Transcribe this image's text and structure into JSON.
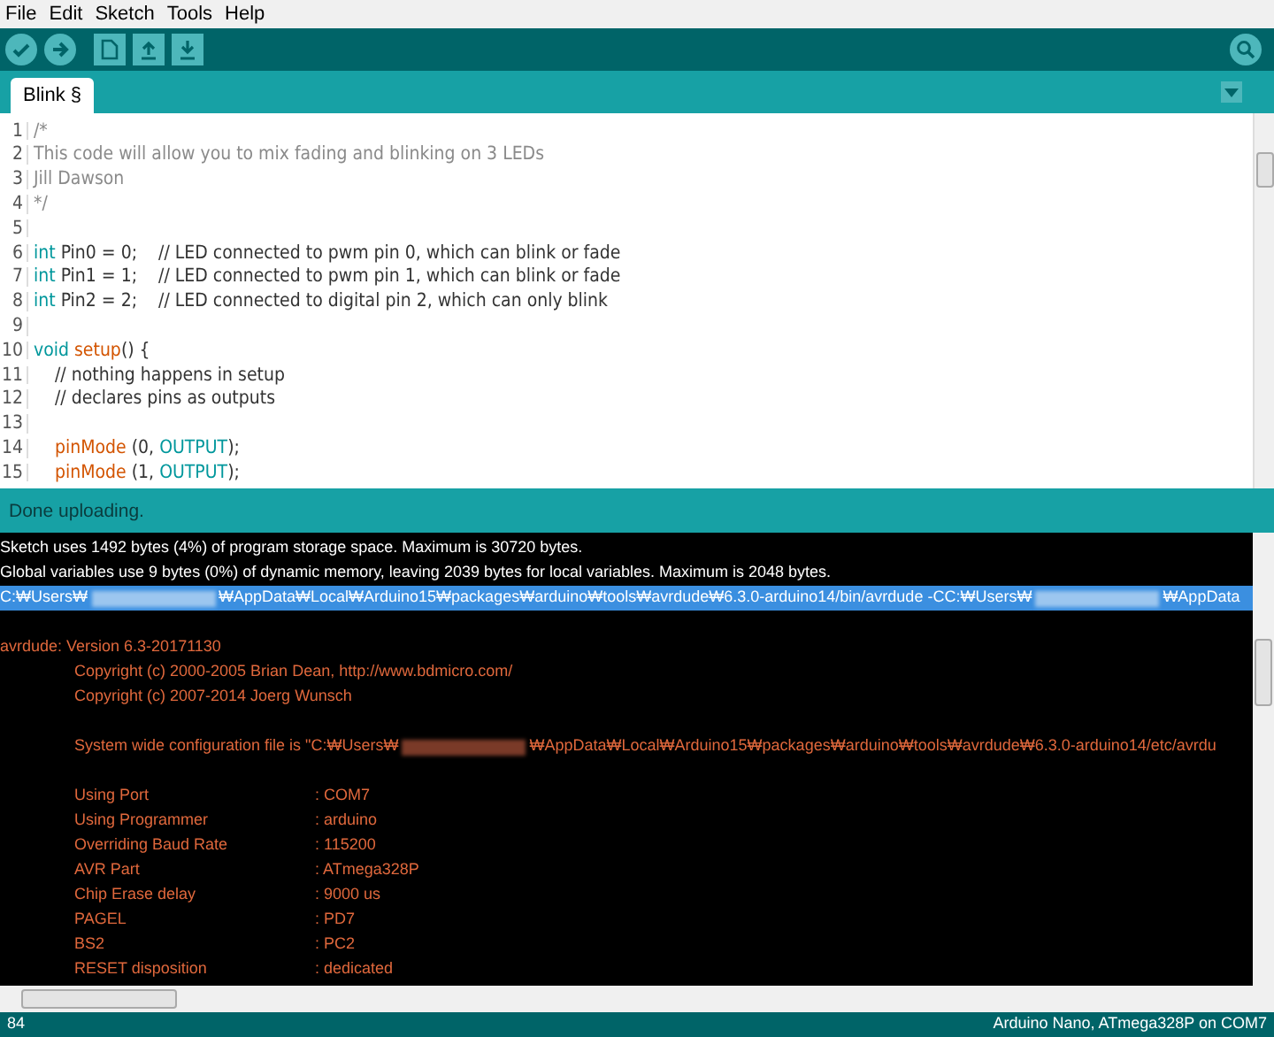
{
  "menu": [
    "File",
    "Edit",
    "Sketch",
    "Tools",
    "Help"
  ],
  "toolbar": [
    {
      "kind": "verify"
    },
    {
      "kind": "upload"
    },
    {
      "kind": "new"
    },
    {
      "kind": "open"
    },
    {
      "kind": "save"
    }
  ],
  "tabs": [
    {
      "label": "Blink §",
      "selected": true
    }
  ],
  "editor": {
    "lines": [
      {
        "number": "1",
        "tokens": [
          {
            "kind": "comment",
            "text": "/*"
          }
        ]
      },
      {
        "number": "2",
        "tokens": [
          {
            "kind": "comment",
            "text": "This code will allow you to mix fading and blinking on 3 LEDs"
          }
        ]
      },
      {
        "number": "3",
        "tokens": [
          {
            "kind": "comment",
            "text": "Jill Dawson"
          }
        ]
      },
      {
        "number": "4",
        "tokens": [
          {
            "kind": "comment",
            "text": "*/"
          }
        ]
      },
      {
        "number": "5"
      },
      {
        "number": "6",
        "tokens": [
          {
            "kind": "keyword",
            "text": "int"
          },
          {
            "kind": "plain",
            "text": " Pin0 = 0;    "
          },
          {
            "kind": "plain",
            "text": "// LED connected to pwm pin 0, which can blink or fade"
          }
        ]
      },
      {
        "number": "7",
        "tokens": [
          {
            "kind": "keyword",
            "text": "int"
          },
          {
            "kind": "plain",
            "text": " Pin1 = 1;    "
          },
          {
            "kind": "plain",
            "text": "// LED connected to pwm pin 1, which can blink or fade"
          }
        ]
      },
      {
        "number": "8",
        "tokens": [
          {
            "kind": "keyword",
            "text": "int"
          },
          {
            "kind": "plain",
            "text": " Pin2 = 2;    "
          },
          {
            "kind": "plain",
            "text": "// LED connected to digital pin 2, which can only blink"
          }
        ]
      },
      {
        "number": "9"
      },
      {
        "number": "10",
        "tokens": [
          {
            "kind": "keyword",
            "text": "void "
          },
          {
            "kind": "function",
            "text": "setup"
          },
          {
            "kind": "plain",
            "text": "() {"
          }
        ]
      },
      {
        "number": "11",
        "tokens": [
          {
            "kind": "plain",
            "text": "    // nothing happens in setup"
          }
        ]
      },
      {
        "number": "12",
        "tokens": [
          {
            "kind": "plain",
            "text": "    // declares pins as outputs"
          }
        ]
      },
      {
        "number": "13"
      },
      {
        "number": "14",
        "tokens": [
          {
            "kind": "function",
            "text": "    pinMode"
          },
          {
            "kind": "plain",
            "text": " (0, "
          },
          {
            "kind": "constant",
            "text": "OUTPUT"
          },
          {
            "kind": "plain",
            "text": ");"
          }
        ]
      },
      {
        "number": "15",
        "tokens": [
          {
            "kind": "function",
            "text": "    pinMode"
          },
          {
            "kind": "plain",
            "text": " (1, "
          },
          {
            "kind": "constant",
            "text": "OUTPUT"
          },
          {
            "kind": "plain",
            "text": ");"
          }
        ]
      }
    ]
  },
  "status": "Done uploading.",
  "console": [
    {
      "kind": "output",
      "segments": [
        {
          "kind": "text",
          "text": "Sketch uses 1492 bytes (4%) of program storage space. Maximum is 30720 bytes."
        }
      ]
    },
    {
      "kind": "output",
      "segments": [
        {
          "kind": "text",
          "text": "Global variables use 9 bytes (0%) of dynamic memory, leaving 2039 bytes for local variables. Maximum is 2048 bytes."
        }
      ]
    },
    {
      "kind": "selected",
      "segments": [
        {
          "kind": "text",
          "text": "C:₩Users₩"
        },
        {
          "kind": "redacted"
        },
        {
          "kind": "text",
          "text": "₩AppData₩Local₩Arduino15₩packages₩arduino₩tools₩avrdude₩6.3.0-arduino14/bin/avrdude -CC:₩Users₩"
        },
        {
          "kind": "redacted"
        },
        {
          "kind": "text",
          "text": "₩AppData"
        }
      ]
    },
    {
      "kind": "blank"
    },
    {
      "kind": "avrdude",
      "segments": [
        {
          "kind": "text",
          "text": "avrdude: Version 6.3-20171130"
        }
      ]
    },
    {
      "kind": "detail",
      "segments": [
        {
          "kind": "text",
          "text": "Copyright (c) 2000-2005 Brian Dean, http://www.bdmicro.com/"
        }
      ]
    },
    {
      "kind": "detail",
      "segments": [
        {
          "kind": "text",
          "text": "Copyright (c) 2007-2014 Joerg Wunsch"
        }
      ]
    },
    {
      "kind": "blank"
    },
    {
      "kind": "detail",
      "segments": [
        {
          "kind": "text",
          "text": "System wide configuration file is \"C:₩Users₩"
        },
        {
          "kind": "redacted"
        },
        {
          "kind": "text",
          "text": "₩AppData₩Local₩Arduino15₩packages₩arduino₩tools₩avrdude₩6.3.0-arduino14/etc/avrdu"
        }
      ]
    },
    {
      "kind": "blank"
    },
    {
      "kind": "field",
      "label": "Using Port",
      "value": ": COM7"
    },
    {
      "kind": "field",
      "label": "Using Programmer",
      "value": ": arduino"
    },
    {
      "kind": "field",
      "label": "Overriding Baud Rate",
      "value": ": 115200"
    },
    {
      "kind": "field",
      "label": "AVR Part",
      "value": ": ATmega328P"
    },
    {
      "kind": "field",
      "label": "Chip Erase delay",
      "value": ": 9000 us"
    },
    {
      "kind": "field",
      "label": "PAGEL",
      "value": ": PD7"
    },
    {
      "kind": "field",
      "label": "BS2",
      "value": ": PC2"
    },
    {
      "kind": "field",
      "label": "RESET disposition",
      "value": ": dedicated"
    }
  ],
  "footer": {
    "line": "84",
    "board": "Arduino Nano, ATmega328P on COM7"
  }
}
